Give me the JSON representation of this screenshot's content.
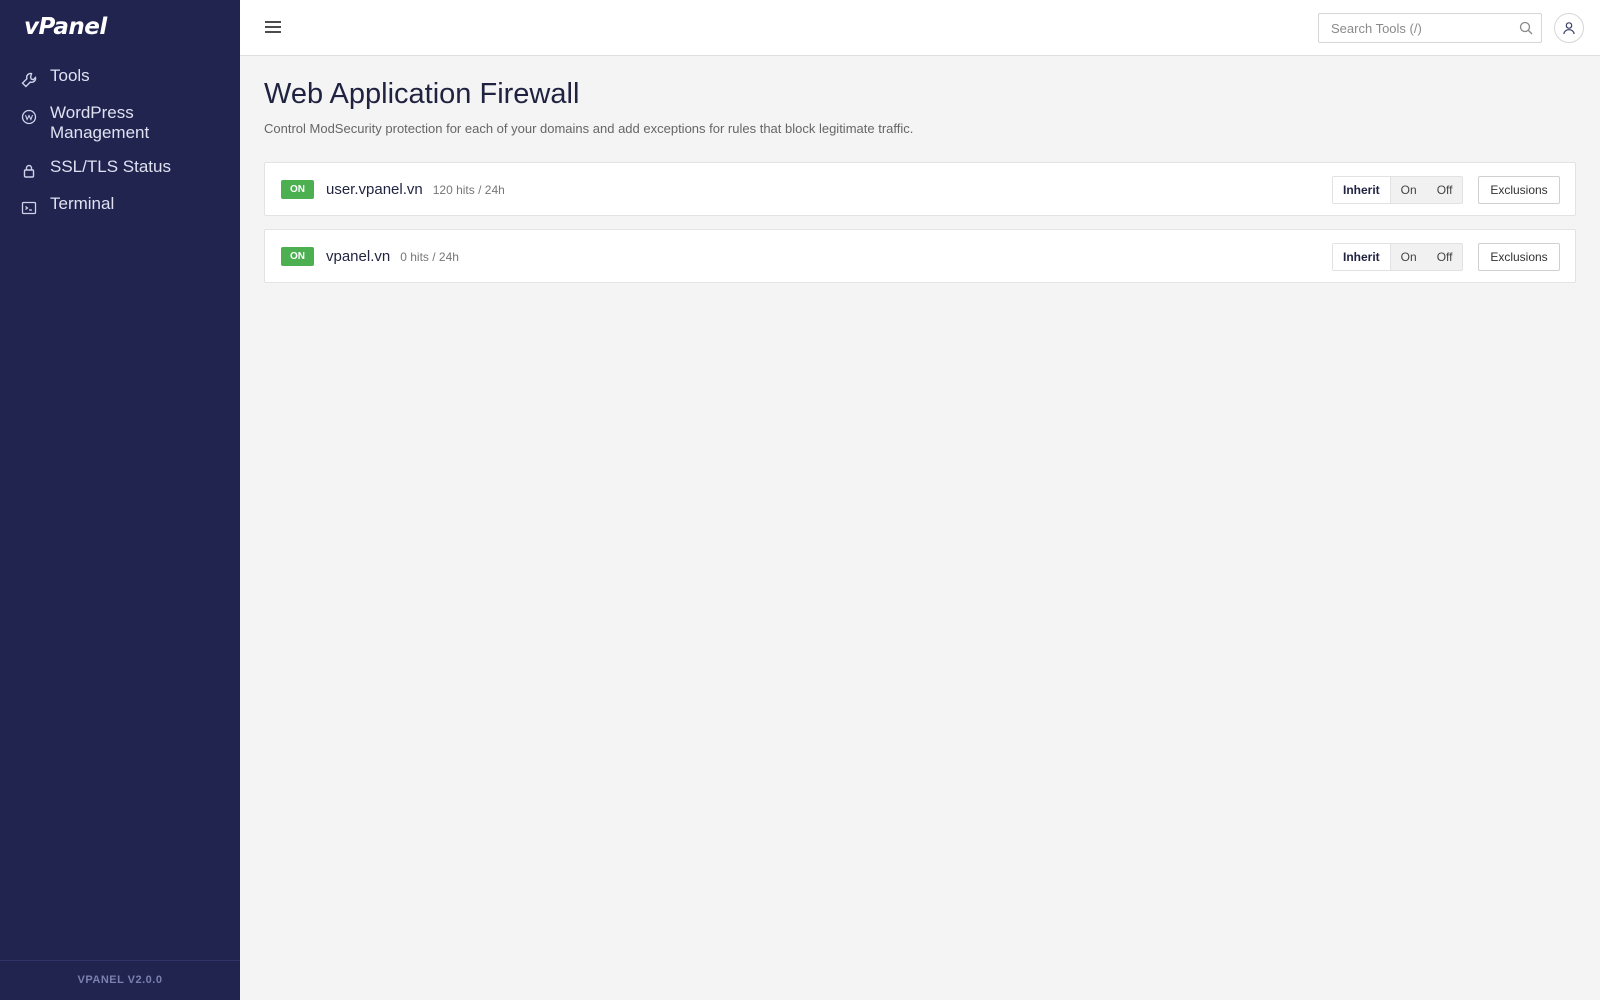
{
  "sidebar": {
    "logo": "vPanel",
    "items": [
      {
        "label": "Tools",
        "icon": "wrench-icon"
      },
      {
        "label": "WordPress Management",
        "icon": "wordpress-icon"
      },
      {
        "label": "SSL/TLS Status",
        "icon": "lock-icon"
      },
      {
        "label": "Terminal",
        "icon": "terminal-icon"
      }
    ],
    "version": "VPANEL V2.0.0"
  },
  "topbar": {
    "search_placeholder": "Search Tools (/)"
  },
  "main": {
    "title": "Web Application Firewall",
    "description": "Control ModSecurity protection for each of your domains and add exceptions for rules that block legitimate traffic.",
    "modes": [
      "Inherit",
      "On",
      "Off"
    ],
    "exclusions_label": "Exclusions",
    "domains": [
      {
        "status": "ON",
        "name": "user.vpanel.vn",
        "hits": "120 hits / 24h",
        "mode": "Inherit"
      },
      {
        "status": "ON",
        "name": "vpanel.vn",
        "hits": "0 hits / 24h",
        "mode": "Inherit"
      }
    ]
  },
  "colors": {
    "sidebar_bg": "#20244f",
    "status_on": "#4caf50",
    "page_bg": "#f4f4f4"
  }
}
